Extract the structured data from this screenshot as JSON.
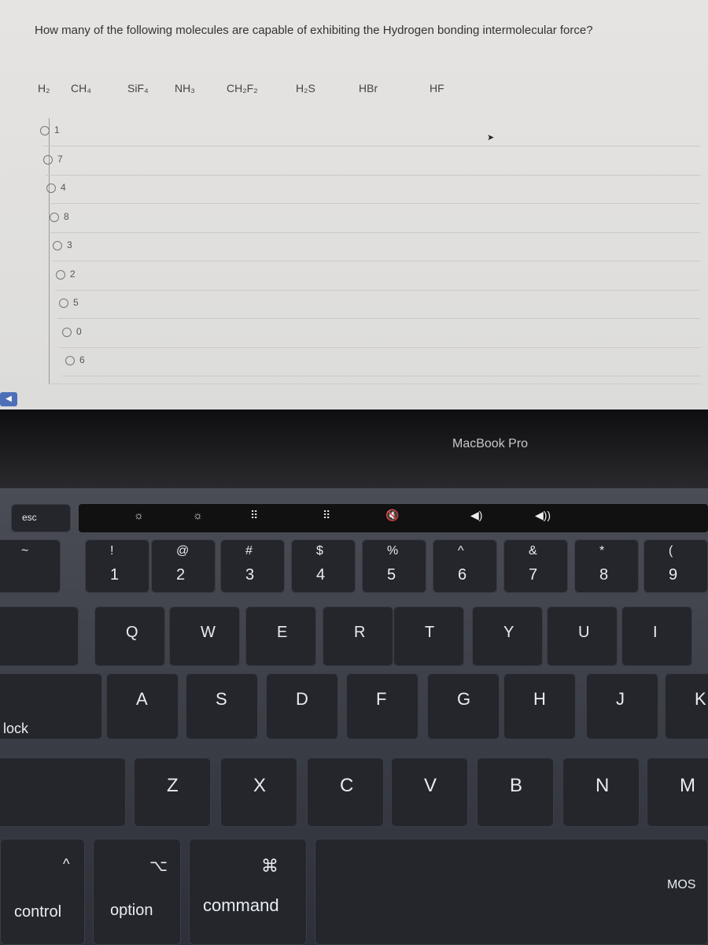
{
  "question": "How many of the following molecules are capable of exhibiting the Hydrogen bonding intermolecular force?",
  "molecules": [
    "H₂",
    "CH₄",
    "SiF₄",
    "NH₃",
    "CH₂F₂",
    "H₂S",
    "HBr",
    "HF"
  ],
  "options": [
    "1",
    "7",
    "4",
    "8",
    "3",
    "2",
    "5",
    "0",
    "6"
  ],
  "laptop_brand": "MacBook Pro",
  "keyboard": {
    "esc": "esc",
    "touchbar": [
      "☼",
      "☼",
      "⠿",
      "⠿",
      "🔇",
      "◀)",
      "◀))"
    ],
    "number_row": [
      [
        "~",
        ""
      ],
      [
        "!",
        "1"
      ],
      [
        "@",
        "2"
      ],
      [
        "#",
        "3"
      ],
      [
        "$",
        "4"
      ],
      [
        "%",
        "5"
      ],
      [
        "^",
        "6"
      ],
      [
        "&",
        "7"
      ],
      [
        "*",
        "8"
      ],
      [
        "(",
        "9"
      ]
    ],
    "qwerty_row": [
      "Q",
      "W",
      "E",
      "R",
      "T",
      "Y",
      "U",
      "I"
    ],
    "asdf_row": [
      "A",
      "S",
      "D",
      "F",
      "G",
      "H",
      "J",
      "K"
    ],
    "zxcv_row": [
      "Z",
      "X",
      "C",
      "V",
      "B",
      "N",
      "M"
    ],
    "caps_label": "lock",
    "control": {
      "symbol": "^",
      "label": "control"
    },
    "option": {
      "symbol": "⌥",
      "label": "option"
    },
    "command": {
      "symbol": "⌘",
      "label": "command"
    },
    "right_partial": "MOS"
  }
}
